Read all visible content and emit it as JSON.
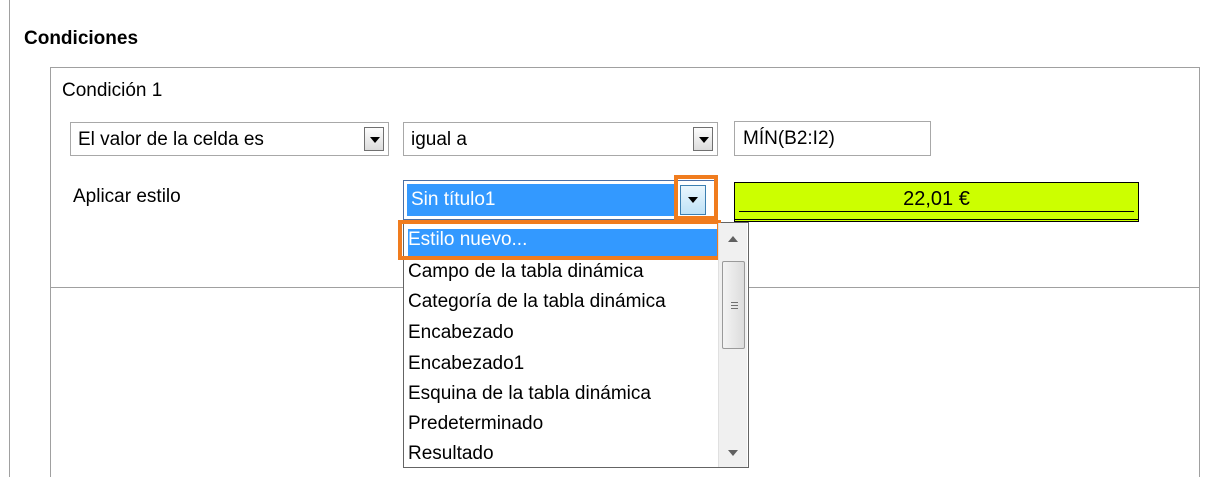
{
  "section": {
    "title": "Condiciones"
  },
  "condition": {
    "label": "Condición 1",
    "type_combo": "El valor de la celda es",
    "operator_combo": "igual a",
    "value_field": "MÍN(B2:I2)",
    "apply_style_label": "Aplicar estilo",
    "style_combo": "Sin título1",
    "preview_value": "22,01 €",
    "preview_bg": "#ccff00"
  },
  "dropdown": {
    "items": [
      "Estilo nuevo...",
      "Campo de la tabla dinámica",
      "Categoría de la tabla dinámica",
      "Encabezado",
      "Encabezado1",
      "Esquina de la tabla dinámica",
      "Predeterminado",
      "Resultado"
    ],
    "highlighted_index": 0
  },
  "colors": {
    "selection": "#3399ff",
    "highlight_outline": "#f07c1e"
  }
}
